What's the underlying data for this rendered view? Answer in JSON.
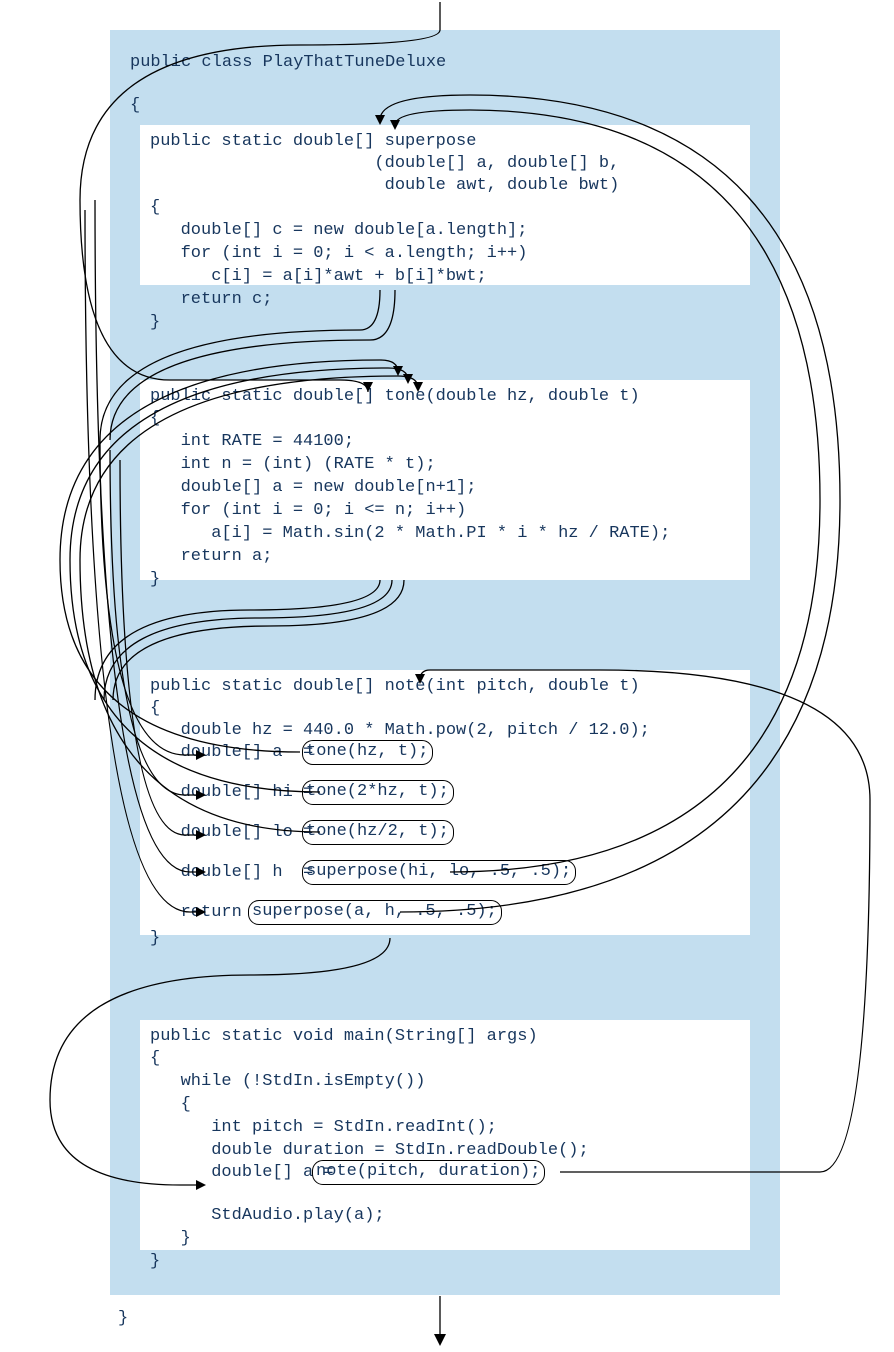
{
  "classDecl": "public class PlayThatTuneDeluxe",
  "openBrace": "{",
  "closeBrace": "}",
  "superpose": {
    "sig1": "public static double[] superpose",
    "sig2": "                      (double[] a, double[] b,",
    "sig3": "                       double awt, double bwt)",
    "body": "{\n   double[] c = new double[a.length];\n   for (int i = 0; i < a.length; i++)\n      c[i] = a[i]*awt + b[i]*bwt;\n   return c;\n}"
  },
  "tone": {
    "sig": "public static double[] tone(double hz, double t)",
    "body": "{\n   int RATE = 44100;\n   int n = (int) (RATE * t);\n   double[] a = new double[n+1];\n   for (int i = 0; i <= n; i++)\n      a[i] = Math.sin(2 * Math.PI * i * hz / RATE);\n   return a;\n}"
  },
  "note": {
    "sig": "public static double[] note(int pitch, double t)",
    "open": "{",
    "l1": "   double hz = 440.0 * Math.pow(2, pitch / 12.0);",
    "l2a": "   double[] a  = ",
    "l2b": "tone(hz, t);",
    "l3a": "   double[] hi = ",
    "l3b": "tone(2*hz, t);",
    "l4a": "   double[] lo = ",
    "l4b": "tone(hz/2, t);",
    "l5a": "   double[] h  = ",
    "l5b": "superpose(hi, lo, .5, .5);",
    "l6a": "   return ",
    "l6b": "superpose(a, h, .5, .5);",
    "close": "}"
  },
  "main": {
    "sig": "public static void main(String[] args)",
    "body1": "{\n   while (!StdIn.isEmpty())\n   {\n      int pitch = StdIn.readInt();\n      double duration = StdIn.readDouble();",
    "l6a": "      double[] a = ",
    "l6b": "note(pitch, duration);",
    "body2": "      StdAudio.play(a);\n   }\n}"
  }
}
